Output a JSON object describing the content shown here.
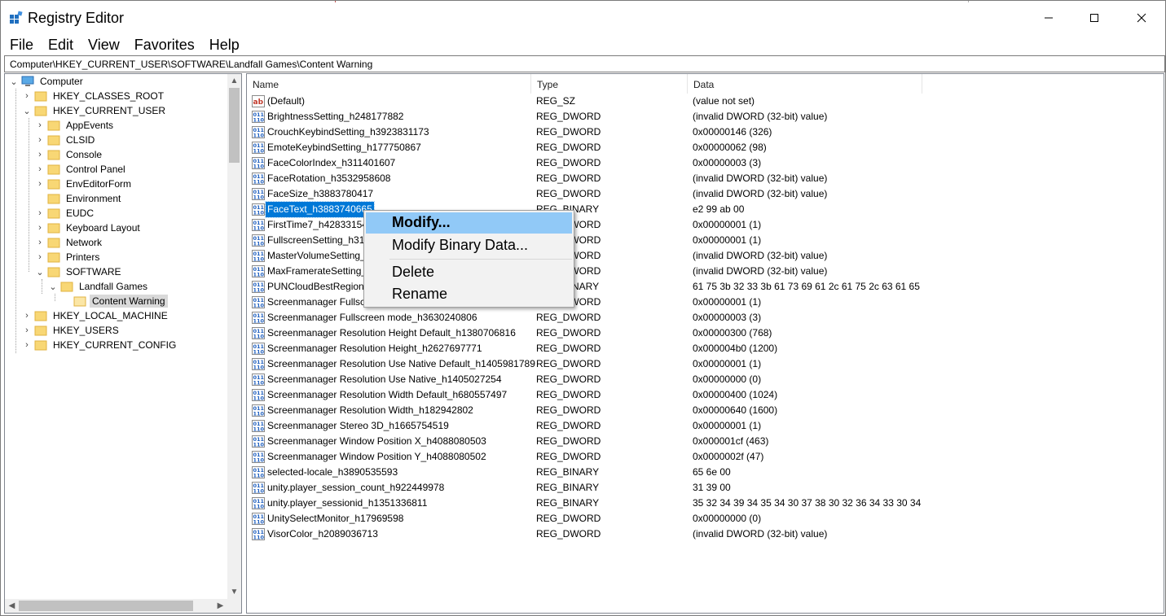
{
  "window": {
    "title": "Registry Editor"
  },
  "menu": [
    "File",
    "Edit",
    "View",
    "Favorites",
    "Help"
  ],
  "address": "Computer\\HKEY_CURRENT_USER\\SOFTWARE\\Landfall Games\\Content Warning",
  "tree": {
    "root": "Computer",
    "hives": [
      "HKEY_CLASSES_ROOT",
      "HKEY_CURRENT_USER",
      "HKEY_LOCAL_MACHINE",
      "HKEY_USERS",
      "HKEY_CURRENT_CONFIG"
    ],
    "hkcu_children": [
      "AppEvents",
      "CLSID",
      "Console",
      "Control Panel",
      "EnvEditorForm",
      "Environment",
      "EUDC",
      "Keyboard Layout",
      "Network",
      "Printers",
      "SOFTWARE"
    ],
    "software_child": "Landfall Games",
    "landfall_child": "Content Warning"
  },
  "columns": [
    "Name",
    "Type",
    "Data"
  ],
  "values": [
    {
      "name": "(Default)",
      "type": "REG_SZ",
      "data": "(value not set)",
      "icon": "string-value-icon"
    },
    {
      "name": "BrightnessSetting_h248177882",
      "type": "REG_DWORD",
      "data": "(invalid DWORD (32-bit) value)",
      "icon": "binary-value-icon"
    },
    {
      "name": "CrouchKeybindSetting_h3923831173",
      "type": "REG_DWORD",
      "data": "0x00000146 (326)",
      "icon": "binary-value-icon"
    },
    {
      "name": "EmoteKeybindSetting_h177750867",
      "type": "REG_DWORD",
      "data": "0x00000062 (98)",
      "icon": "binary-value-icon"
    },
    {
      "name": "FaceColorIndex_h311401607",
      "type": "REG_DWORD",
      "data": "0x00000003 (3)",
      "icon": "binary-value-icon"
    },
    {
      "name": "FaceRotation_h3532958608",
      "type": "REG_DWORD",
      "data": "(invalid DWORD (32-bit) value)",
      "icon": "binary-value-icon"
    },
    {
      "name": "FaceSize_h3883780417",
      "type": "REG_DWORD",
      "data": "(invalid DWORD (32-bit) value)",
      "icon": "binary-value-icon"
    },
    {
      "name": "FaceText_h3883740665",
      "type": "REG_BINARY",
      "data": "e2 99 ab 00",
      "icon": "binary-value-icon"
    },
    {
      "name": "FirstTime7_h428331542",
      "type": "REG_DWORD",
      "data": "0x00000001 (1)",
      "icon": "binary-value-icon"
    },
    {
      "name": "FullscreenSetting_h317",
      "type": "REG_DWORD",
      "data": "0x00000001 (1)",
      "icon": "binary-value-icon"
    },
    {
      "name": "MasterVolumeSetting_",
      "type": "REG_DWORD",
      "data": "(invalid DWORD (32-bit) value)",
      "icon": "binary-value-icon"
    },
    {
      "name": "MaxFramerateSetting_",
      "type": "REG_DWORD",
      "data": "(invalid DWORD (32-bit) value)",
      "icon": "binary-value-icon"
    },
    {
      "name": "PUNCloudBestRegion_",
      "type": "REG_BINARY",
      "data": "61 75 3b 32 33 3b 61 73 69 61 2c 61 75 2c 63 61 65 2...",
      "icon": "binary-value-icon"
    },
    {
      "name": "Screenmanager Fullscr",
      "type": "REG_DWORD",
      "data": "0x00000001 (1)",
      "icon": "binary-value-icon"
    },
    {
      "name": "Screenmanager Fullscreen mode_h3630240806",
      "type": "REG_DWORD",
      "data": "0x00000003 (3)",
      "icon": "binary-value-icon"
    },
    {
      "name": "Screenmanager Resolution Height Default_h1380706816",
      "type": "REG_DWORD",
      "data": "0x00000300 (768)",
      "icon": "binary-value-icon"
    },
    {
      "name": "Screenmanager Resolution Height_h2627697771",
      "type": "REG_DWORD",
      "data": "0x000004b0 (1200)",
      "icon": "binary-value-icon"
    },
    {
      "name": "Screenmanager Resolution Use Native Default_h1405981789",
      "type": "REG_DWORD",
      "data": "0x00000001 (1)",
      "icon": "binary-value-icon"
    },
    {
      "name": "Screenmanager Resolution Use Native_h1405027254",
      "type": "REG_DWORD",
      "data": "0x00000000 (0)",
      "icon": "binary-value-icon"
    },
    {
      "name": "Screenmanager Resolution Width Default_h680557497",
      "type": "REG_DWORD",
      "data": "0x00000400 (1024)",
      "icon": "binary-value-icon"
    },
    {
      "name": "Screenmanager Resolution Width_h182942802",
      "type": "REG_DWORD",
      "data": "0x00000640 (1600)",
      "icon": "binary-value-icon"
    },
    {
      "name": "Screenmanager Stereo 3D_h1665754519",
      "type": "REG_DWORD",
      "data": "0x00000001 (1)",
      "icon": "binary-value-icon"
    },
    {
      "name": "Screenmanager Window Position X_h4088080503",
      "type": "REG_DWORD",
      "data": "0x000001cf (463)",
      "icon": "binary-value-icon"
    },
    {
      "name": "Screenmanager Window Position Y_h4088080502",
      "type": "REG_DWORD",
      "data": "0x0000002f (47)",
      "icon": "binary-value-icon"
    },
    {
      "name": "selected-locale_h3890535593",
      "type": "REG_BINARY",
      "data": "65 6e 00",
      "icon": "binary-value-icon"
    },
    {
      "name": "unity.player_session_count_h922449978",
      "type": "REG_BINARY",
      "data": "31 39 00",
      "icon": "binary-value-icon"
    },
    {
      "name": "unity.player_sessionid_h1351336811",
      "type": "REG_BINARY",
      "data": "35 32 34 39 34 35 34 30 37 38 30 32 36 34 33 30 34 30...",
      "icon": "binary-value-icon"
    },
    {
      "name": "UnitySelectMonitor_h17969598",
      "type": "REG_DWORD",
      "data": "0x00000000 (0)",
      "icon": "binary-value-icon"
    },
    {
      "name": "VisorColor_h2089036713",
      "type": "REG_DWORD",
      "data": "(invalid DWORD (32-bit) value)",
      "icon": "binary-value-icon"
    }
  ],
  "selected_value": "FaceText_h3883740665",
  "context_menu": [
    "Modify...",
    "Modify Binary Data...",
    "Delete",
    "Rename"
  ],
  "colors": {
    "selection": "#0078d7",
    "menu_highlight": "#91c9f7",
    "folder": "#f8d775"
  }
}
